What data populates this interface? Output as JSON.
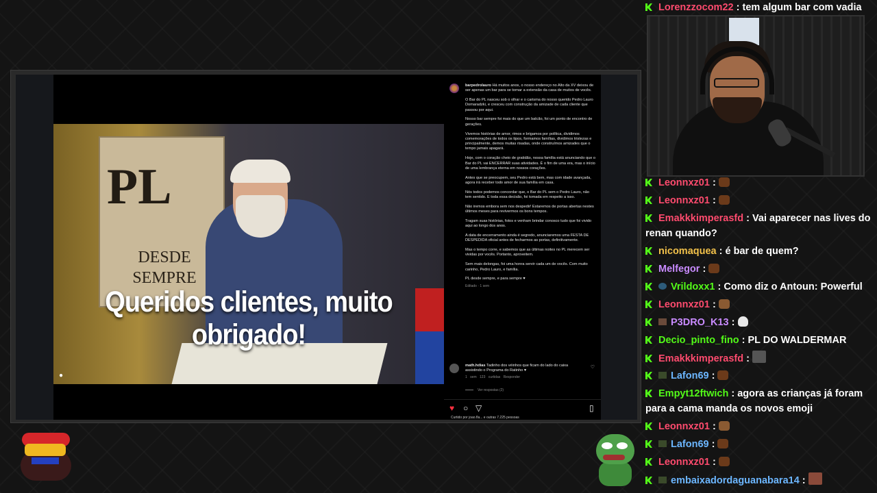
{
  "instagram": {
    "overlay_title": "Queridos clientes, muito obrigado!",
    "sign_pl": "PL",
    "sign_desde": "DESDE",
    "sign_sempre": "SEMPRE",
    "author": "barpedrolauro",
    "caption_paragraphs": [
      "Há muitos anos, o nosso endereço no Alto da XV deixou de ser apenas um bar para se tornar a extensão da casa de muitos de vocês.",
      "O Bar do PL nasceu sob o olhar e o carisma do nosso querido Pedro Lauro Domaradzki, e cresceu com construção da amizade de cada cliente que passou por aqui.",
      "Nosso bar sempre foi mais do que um balcão, foi um ponto de encontro de gerações.",
      "Vivemos histórias de amor, rimos e brigamos por política, dividimos comemorações de todos os tipos, formamos famílias, dividimos tristezas e principalmente, demos muitas risadas, onde construímos amizades que o tempo jamais apagará.",
      "Hoje, com o coração cheio de gratidão, nossa família está anunciando que o Bar do PL vai ENCERRAR suas atividades. É o fim de uma era, mas o início de uma lembrança eterna em nossos corações.",
      "Antes que se preocupem, seu Pedro está bem, mas com idade avançada, agora irá receber todo amor de sua família em casa.",
      "Nós todos podemos concordar que, o Bar do PL sem o Pedro Lauro, não tem sentido. E toda essa decisão, foi tomada em respeito a isso.",
      "Não iremos embora sem nos despedir! Estaremos de portas abertas nestes últimos meses para revivermos os bons tempos.",
      "Tragam suas histórias, fotos e venham brindar conosco tudo que foi vivido aqui ao longo dos anos.",
      "A data de encerramento ainda é segredo, anunciaremos uma FESTA DE DESPEDIDA oficial antes de fecharmos as portas, definitivamente.",
      "Mas o tempo corre, e sabemos que as últimas noites no PL merecem ser vividas por vocês. Portanto, aproveitem.",
      "Sem mais delongas, foi uma honra servir cada um de vocês. Com muito carinho, Pedro Lauro, e família.",
      "PL desde sempre, e para sempre ♥"
    ],
    "edited_label": "Editado · 1 sem",
    "comment": {
      "user": "math.hdias",
      "text": "Tadinho dos véinhos que ficam do lado do caixa assistindo o Programa do Ratinho ♥",
      "meta": "1 sem   123 curtidas   Responder"
    },
    "view_replies": "Ver respostas (2)",
    "likes_line": "Curtido por joao.fla... e outras 7.225 pessoas",
    "icons": [
      "heart-icon",
      "comment-icon",
      "share-icon",
      "bookmark-icon"
    ]
  },
  "chat": {
    "colors": {
      "kick_green": "#53fc18"
    },
    "messages": [
      {
        "user": "Lorenzzocom22",
        "color": "#ff4b6e",
        "text": "tem algum bar com vadia",
        "emote": ""
      },
      {
        "user": "Leonnxz01",
        "color": "#ff4b6e",
        "text": "",
        "emote": "bar-emote"
      },
      {
        "user": "Leonnxz01",
        "color": "#ff4b6e",
        "text": "",
        "emote": "bar-emote"
      },
      {
        "user": "Emakkkimperasfd",
        "color": "#ff4b6e",
        "text": "Vai aparecer nas lives do renan quando?",
        "emote": ""
      },
      {
        "user": "nicomaquea",
        "color": "#f2c14a",
        "text": "é bar de quem?",
        "emote": ""
      },
      {
        "user": "Melfegor",
        "color": "#c98bff",
        "text": "",
        "emote": "bar-emote"
      },
      {
        "user": "Vrildoxx1",
        "color": "#53fc18",
        "text": "Como diz o Antoun: Powerful",
        "emote": ""
      },
      {
        "user": "Leonnxz01",
        "color": "#ff4b6e",
        "text": "",
        "emote": "monkey-emote"
      },
      {
        "user": "P3DRO_K13",
        "color": "#c98bff",
        "text": "",
        "emote": "skull-emote"
      },
      {
        "user": "Decio_pinto_fino",
        "color": "#53fc18",
        "text": "PL DO WALDERMAR",
        "emote": ""
      },
      {
        "user": "Emakkkimperasfd",
        "color": "#ff4b6e",
        "text": "",
        "emote": "photo-emote"
      },
      {
        "user": "Lafon69",
        "color": "#6cb6ff",
        "text": "",
        "emote": "bar-emote"
      },
      {
        "user": "Empyt12ftwich",
        "color": "#53fc18",
        "text": "agora as crianças já foram para a cama manda os novos emoji",
        "emote": ""
      },
      {
        "user": "Leonnxz01",
        "color": "#ff4b6e",
        "text": "",
        "emote": "monkey-emote"
      },
      {
        "user": "Lafon69",
        "color": "#6cb6ff",
        "text": "",
        "emote": "bar-emote"
      },
      {
        "user": "Leonnxz01",
        "color": "#ff4b6e",
        "text": "",
        "emote": "bar-emote"
      },
      {
        "user": "embaixadordaguanabara14",
        "color": "#6cb6ff",
        "text": "",
        "emote": "photo-emote"
      }
    ]
  }
}
